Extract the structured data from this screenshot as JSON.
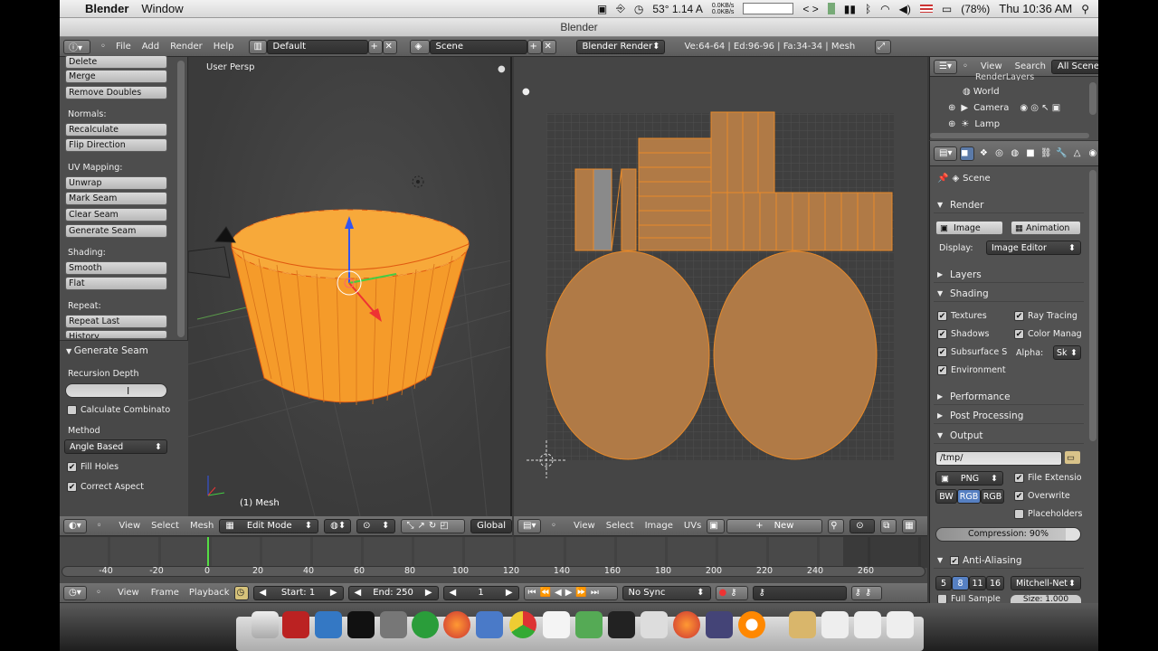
{
  "menubar": {
    "app_name": "Blender",
    "menu_window": "Window",
    "temp": "53° 1.14 A",
    "net_up": "0.0KB/s",
    "net_down": "0.0KB/s",
    "battery": "(78%)",
    "clock": "Thu 10:36 AM"
  },
  "window_title": "Blender",
  "info_header": {
    "menu_file": "File",
    "menu_add": "Add",
    "menu_render": "Render",
    "menu_help": "Help",
    "layout": "Default",
    "scene": "Scene",
    "engine": "Blender Render",
    "stats": "Ve:64-64 | Ed:96-96 | Fa:34-34 | Mesh"
  },
  "toolshelf": {
    "btn_delete": "Delete",
    "btn_merge": "Merge",
    "btn_remove_doubles": "Remove Doubles",
    "lbl_normals": "Normals:",
    "btn_recalculate": "Recalculate",
    "btn_flip_direction": "Flip Direction",
    "lbl_uv_mapping": "UV Mapping:",
    "btn_unwrap": "Unwrap",
    "btn_mark_seam": "Mark Seam",
    "btn_clear_seam": "Clear Seam",
    "btn_generate_seam": "Generate Seam",
    "lbl_shading": "Shading:",
    "btn_smooth": "Smooth",
    "btn_flat": "Flat",
    "lbl_repeat": "Repeat:",
    "btn_repeat_last": "Repeat Last",
    "btn_history": "History"
  },
  "operator_panel": {
    "title": "Generate Seam",
    "lbl_recursion_depth": "Recursion Depth",
    "recursion_depth_value": "",
    "chk_calculate": "Calculate Combinato",
    "lbl_method": "Method",
    "method_value": "Angle Based",
    "chk_fill_holes": "Fill Holes",
    "chk_correct_aspect": "Correct Aspect"
  },
  "viewport3d": {
    "view_name": "User Persp",
    "object_label": "(1) Mesh",
    "header_view": "View",
    "header_select": "Select",
    "header_mesh": "Mesh",
    "mode": "Edit Mode",
    "orientation": "Global"
  },
  "uv_editor": {
    "header_view": "View",
    "header_select": "Select",
    "header_image": "Image",
    "header_uvs": "UVs",
    "new_button": "New"
  },
  "outliner": {
    "header_view": "View",
    "header_search": "Search",
    "header_all_scenes": "All Scenes",
    "item_render_layers": "RenderLayers",
    "item_world": "World",
    "item_camera": "Camera",
    "item_lamp": "Lamp"
  },
  "properties": {
    "context_scene": "Scene",
    "panel_render": "Render",
    "btn_image": "Image",
    "btn_animation": "Animation",
    "lbl_display": "Display:",
    "display_value": "Image Editor",
    "panel_layers": "Layers",
    "panel_shading": "Shading",
    "chk_textures": "Textures",
    "chk_ray_tracing": "Ray Tracing",
    "chk_shadows": "Shadows",
    "chk_color_manag": "Color Manag",
    "chk_subsurface": "Subsurface S",
    "lbl_alpha": "Alpha:",
    "alpha_value": "Sk",
    "chk_environment": "Environment",
    "panel_performance": "Performance",
    "panel_post_processing": "Post Processing",
    "panel_output": "Output",
    "output_path": "/tmp/",
    "format_value": "PNG",
    "chk_file_extension": "File Extensio",
    "color_bw": "BW",
    "color_rgb": "RGB",
    "color_rgba": "RGB",
    "chk_overwrite": "Overwrite",
    "chk_placeholders": "Placeholders",
    "compression": "Compression: 90%",
    "panel_anti_aliasing": "Anti-Aliasing",
    "aa_5": "5",
    "aa_8": "8",
    "aa_11": "11",
    "aa_16": "16",
    "aa_filter": "Mitchell-Net",
    "chk_full_sample": "Full Sample",
    "size_value": "Size: 1.000"
  },
  "timeline": {
    "ticks": [
      "-40",
      "-20",
      "0",
      "20",
      "40",
      "60",
      "80",
      "100",
      "120",
      "140",
      "160",
      "180",
      "200",
      "220",
      "240",
      "260"
    ],
    "header_view": "View",
    "header_frame": "Frame",
    "header_playback": "Playback",
    "start": "Start: 1",
    "end": "End: 250",
    "current": "1",
    "sync": "No Sync"
  },
  "colors": {
    "mesh_orange": "#f59b2a",
    "uv_fill": "#b07a46",
    "panel_bg": "#525252"
  }
}
